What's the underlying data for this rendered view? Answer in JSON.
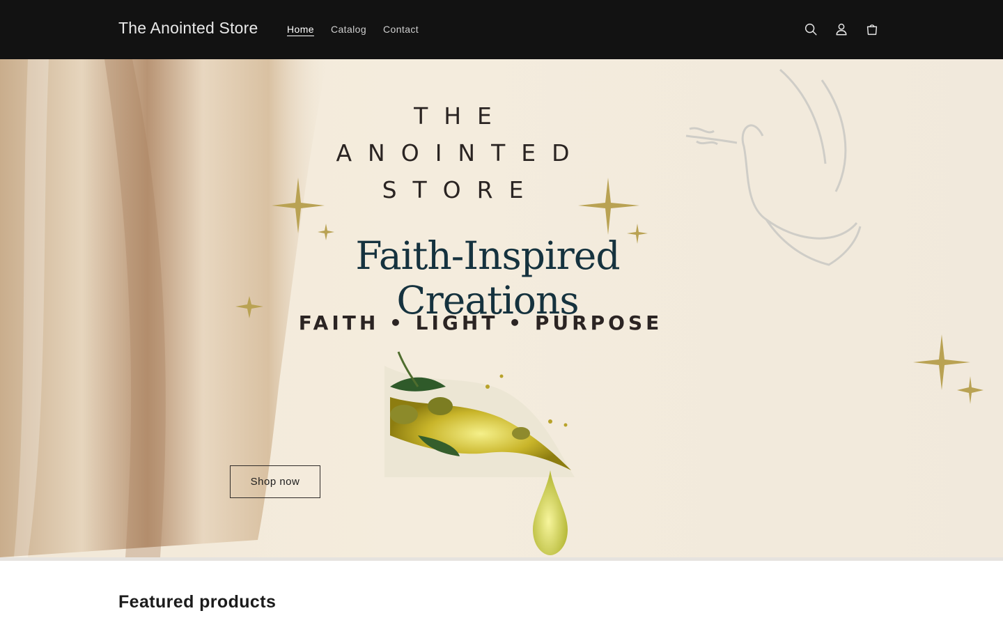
{
  "header": {
    "brand": "The Anointed Store",
    "nav": [
      {
        "label": "Home",
        "active": true
      },
      {
        "label": "Catalog",
        "active": false
      },
      {
        "label": "Contact",
        "active": false
      }
    ],
    "icons": [
      "search-icon",
      "account-icon",
      "cart-icon"
    ]
  },
  "hero": {
    "title_lines": [
      "THE",
      "ANOINTED",
      "STORE"
    ],
    "tagline": "Faith-Inspired Creations",
    "subtitle": "FAITH • LIGHT • PURPOSE",
    "button_label": "Shop now"
  },
  "featured": {
    "heading": "Featured products"
  },
  "colors": {
    "header_bg": "#121212",
    "hero_bg": "#f2e8d8",
    "tagline": "#15323e",
    "gold": "#b9a253"
  }
}
